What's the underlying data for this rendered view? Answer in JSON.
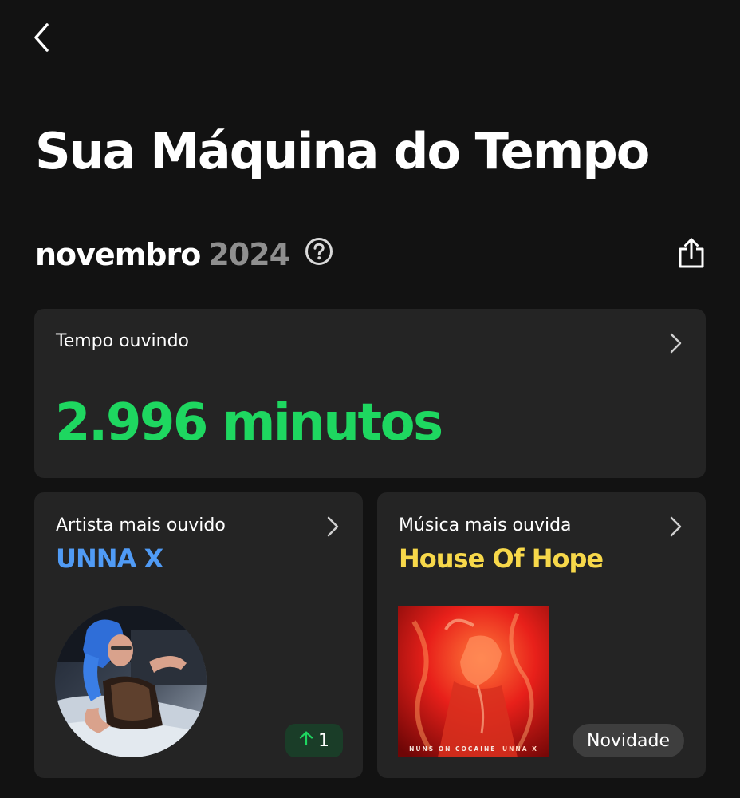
{
  "header": {
    "back_icon": "chevron-left-icon",
    "title": "Sua Máquina do Tempo"
  },
  "period": {
    "month": "novembro",
    "year": "2024",
    "help_icon": "question-circle-icon",
    "share_icon": "share-icon"
  },
  "listening_time": {
    "label": "Tempo ouvindo",
    "value": "2.996 minutos",
    "chevron_icon": "chevron-right-icon"
  },
  "top_artist": {
    "label": "Artista mais ouvido",
    "name": "UNNA X",
    "rank_change": "1",
    "rank_icon": "arrow-up-icon",
    "chevron_icon": "chevron-right-icon"
  },
  "top_track": {
    "label": "Música mais ouvida",
    "name": "House Of Hope",
    "cover_title": "NUNS ON COCAINE",
    "cover_artist": "UNNA X",
    "badge": "Novidade",
    "chevron_icon": "chevron-right-icon"
  },
  "colors": {
    "background": "#121212",
    "card": "#242424",
    "time_accent": "#1ed760",
    "artist_accent": "#509bf5",
    "track_accent": "#f7d84a",
    "rank_badge_bg": "#1a3d28",
    "rank_arrow": "#1ed760",
    "new_badge_bg": "#3e3e3e",
    "year": "#8f8f8f"
  }
}
